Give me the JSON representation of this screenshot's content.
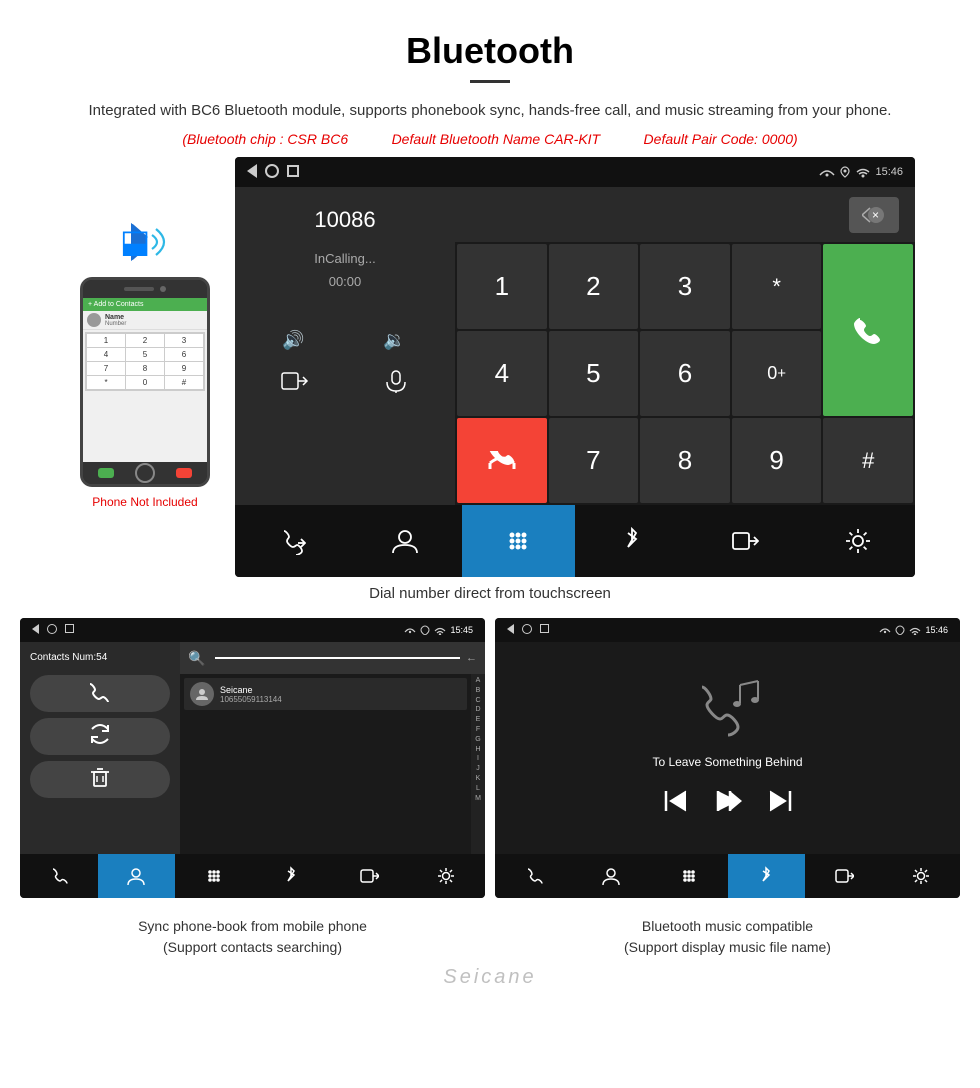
{
  "header": {
    "title": "Bluetooth",
    "description": "Integrated with BC6 Bluetooth module, supports phonebook sync, hands-free call, and music streaming from your phone.",
    "specs": {
      "chip": "(Bluetooth chip : CSR BC6",
      "name": "Default Bluetooth Name CAR-KIT",
      "pair": "Default Pair Code: 0000)"
    }
  },
  "main_screen": {
    "status_bar": {
      "time": "15:46",
      "back_btn": "◁",
      "home_btn": "○",
      "recents_btn": "□"
    },
    "dial": {
      "number": "10086",
      "status": "InCalling...",
      "timer": "00:00",
      "controls": {
        "vol_up": "🔊",
        "vol_down": "🔉",
        "transfer": "📲",
        "mic": "🎤"
      }
    },
    "numpad": {
      "keys": [
        "1",
        "2",
        "3",
        "*",
        "4",
        "5",
        "6",
        "0+",
        "7",
        "8",
        "9",
        "#"
      ]
    },
    "nav": {
      "items": [
        "phone-transfer",
        "contacts",
        "dialpad",
        "bluetooth",
        "transfer2",
        "settings"
      ]
    }
  },
  "caption_main": "Dial number direct from touchscreen",
  "contacts_screen": {
    "status_bar": {
      "time": "15:45"
    },
    "contacts_num": "Contacts Num:54",
    "contact": {
      "name": "Seicane",
      "number": "10655059113144"
    },
    "search_placeholder": "Search",
    "alphabet": [
      "A",
      "B",
      "C",
      "D",
      "E",
      "F",
      "G",
      "H",
      "I",
      "J",
      "K",
      "L",
      "M"
    ],
    "nav_active": "contacts"
  },
  "music_screen": {
    "status_bar": {
      "time": "15:46"
    },
    "song_title": "To Leave Something Behind",
    "controls": {
      "prev": "⏮",
      "play": "⏭",
      "next": "⏭"
    },
    "nav_active": "bluetooth"
  },
  "caption_contacts": {
    "line1": "Sync phone-book from mobile phone",
    "line2": "(Support contacts searching)"
  },
  "caption_music": {
    "line1": "Bluetooth music compatible",
    "line2": "(Support display music file name)"
  },
  "watermark": "Seicane",
  "phone_not_included": "Phone Not Included"
}
